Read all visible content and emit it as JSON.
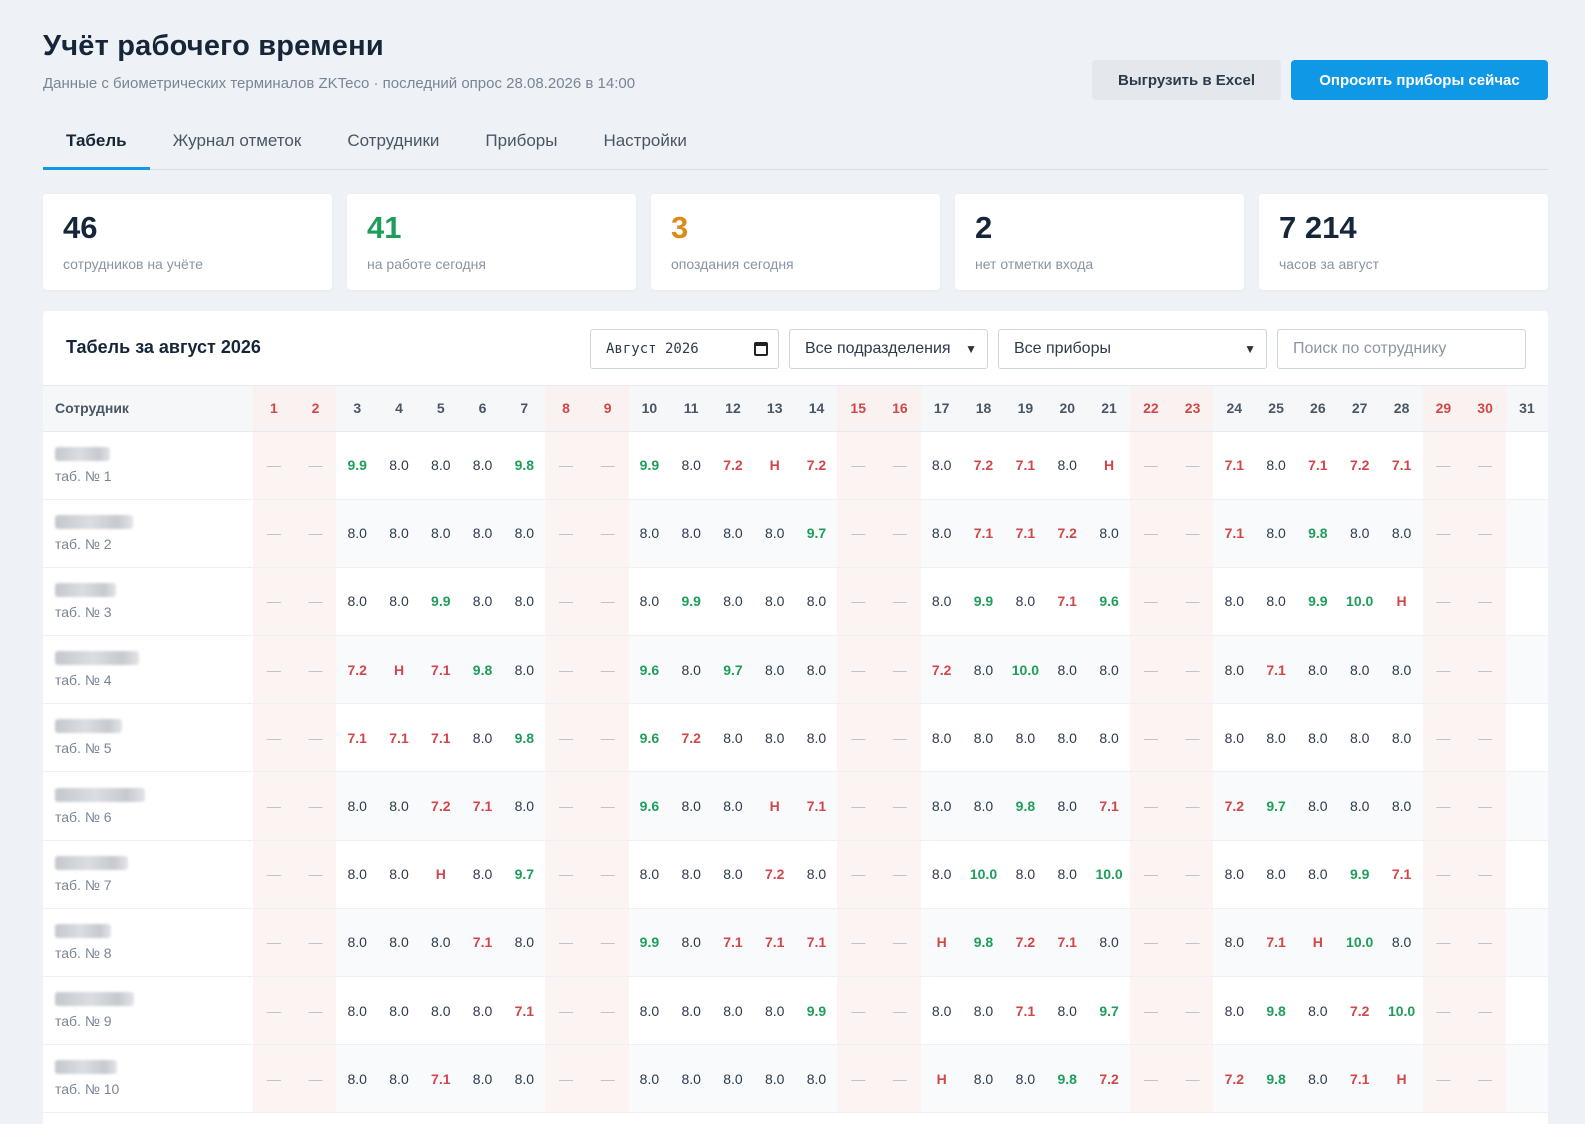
{
  "header": {
    "title": "Учёт рабочего времени",
    "subtitle": "Данные с биометрических терминалов ZKTeco · последний опрос 28.08.2026 в 14:00",
    "export_label": "Выгрузить в Excel",
    "poll_label": "Опросить приборы сейчас"
  },
  "tabs": [
    {
      "label": "Табель",
      "active": true
    },
    {
      "label": "Журнал отметок",
      "active": false
    },
    {
      "label": "Сотрудники",
      "active": false
    },
    {
      "label": "Приборы",
      "active": false
    },
    {
      "label": "Настройки",
      "active": false
    }
  ],
  "stats": [
    {
      "value": "46",
      "label": "сотрудников на учёте",
      "color": "#16263a"
    },
    {
      "value": "41",
      "label": "на работе сегодня",
      "color": "#1f9d5a"
    },
    {
      "value": "3",
      "label": "опоздания сегодня",
      "color": "#d98c1a"
    },
    {
      "value": "2",
      "label": "нет отметки входа",
      "color": "#16263a"
    },
    {
      "value": "7 214",
      "label": "часов за август",
      "color": "#16263a"
    }
  ],
  "timesheet": {
    "title": "Табель за август 2026",
    "month_value": "Август 2026",
    "dept_select": "Все подразделения",
    "device_select": "Все приборы",
    "search_placeholder": "Поиск по сотруднику",
    "employee_header": "Сотрудник",
    "days": [
      "1",
      "2",
      "3",
      "4",
      "5",
      "6",
      "7",
      "8",
      "9",
      "10",
      "11",
      "12",
      "13",
      "14",
      "15",
      "16",
      "17",
      "18",
      "19",
      "20",
      "21",
      "22",
      "23",
      "24",
      "25",
      "26",
      "27",
      "28",
      "29",
      "30",
      "31"
    ],
    "weekends": [
      1,
      2,
      8,
      9,
      15,
      16,
      22,
      23,
      29,
      30
    ],
    "rows": [
      {
        "tab": "таб. № 1",
        "values": [
          "—",
          "—",
          "9.9",
          "8.0",
          "8.0",
          "8.0",
          "9.8",
          "—",
          "—",
          "9.9",
          "8.0",
          "7.2",
          "Н",
          "7.2",
          "—",
          "—",
          "8.0",
          "7.2",
          "7.1",
          "8.0",
          "Н",
          "—",
          "—",
          "7.1",
          "8.0",
          "7.1",
          "7.2",
          "7.1",
          "—",
          "—"
        ]
      },
      {
        "tab": "таб. № 2",
        "values": [
          "—",
          "—",
          "8.0",
          "8.0",
          "8.0",
          "8.0",
          "8.0",
          "—",
          "—",
          "8.0",
          "8.0",
          "8.0",
          "8.0",
          "9.7",
          "—",
          "—",
          "8.0",
          "7.1",
          "7.1",
          "7.2",
          "8.0",
          "—",
          "—",
          "7.1",
          "8.0",
          "9.8",
          "8.0",
          "8.0",
          "—",
          "—"
        ]
      },
      {
        "tab": "таб. № 3",
        "values": [
          "—",
          "—",
          "8.0",
          "8.0",
          "9.9",
          "8.0",
          "8.0",
          "—",
          "—",
          "8.0",
          "9.9",
          "8.0",
          "8.0",
          "8.0",
          "—",
          "—",
          "8.0",
          "9.9",
          "8.0",
          "7.1",
          "9.6",
          "—",
          "—",
          "8.0",
          "8.0",
          "9.9",
          "10.0",
          "Н",
          "—",
          "—"
        ]
      },
      {
        "tab": "таб. № 4",
        "values": [
          "—",
          "—",
          "7.2",
          "Н",
          "7.1",
          "9.8",
          "8.0",
          "—",
          "—",
          "9.6",
          "8.0",
          "9.7",
          "8.0",
          "8.0",
          "—",
          "—",
          "7.2",
          "8.0",
          "10.0",
          "8.0",
          "8.0",
          "—",
          "—",
          "8.0",
          "7.1",
          "8.0",
          "8.0",
          "8.0",
          "—",
          "—"
        ]
      },
      {
        "tab": "таб. № 5",
        "values": [
          "—",
          "—",
          "7.1",
          "7.1",
          "7.1",
          "8.0",
          "9.8",
          "—",
          "—",
          "9.6",
          "7.2",
          "8.0",
          "8.0",
          "8.0",
          "—",
          "—",
          "8.0",
          "8.0",
          "8.0",
          "8.0",
          "8.0",
          "—",
          "—",
          "8.0",
          "8.0",
          "8.0",
          "8.0",
          "8.0",
          "—",
          "—"
        ]
      },
      {
        "tab": "таб. № 6",
        "values": [
          "—",
          "—",
          "8.0",
          "8.0",
          "7.2",
          "7.1",
          "8.0",
          "—",
          "—",
          "9.6",
          "8.0",
          "8.0",
          "Н",
          "7.1",
          "—",
          "—",
          "8.0",
          "8.0",
          "9.8",
          "8.0",
          "7.1",
          "—",
          "—",
          "7.2",
          "9.7",
          "8.0",
          "8.0",
          "8.0",
          "—",
          "—"
        ]
      },
      {
        "tab": "таб. № 7",
        "values": [
          "—",
          "—",
          "8.0",
          "8.0",
          "Н",
          "8.0",
          "9.7",
          "—",
          "—",
          "8.0",
          "8.0",
          "8.0",
          "7.2",
          "8.0",
          "—",
          "—",
          "8.0",
          "10.0",
          "8.0",
          "8.0",
          "10.0",
          "—",
          "—",
          "8.0",
          "8.0",
          "8.0",
          "9.9",
          "7.1",
          "—",
          "—"
        ]
      },
      {
        "tab": "таб. № 8",
        "values": [
          "—",
          "—",
          "8.0",
          "8.0",
          "8.0",
          "7.1",
          "8.0",
          "—",
          "—",
          "9.9",
          "8.0",
          "7.1",
          "7.1",
          "7.1",
          "—",
          "—",
          "Н",
          "9.8",
          "7.2",
          "7.1",
          "8.0",
          "—",
          "—",
          "8.0",
          "7.1",
          "Н",
          "10.0",
          "8.0",
          "—",
          "—"
        ]
      },
      {
        "tab": "таб. № 9",
        "values": [
          "—",
          "—",
          "8.0",
          "8.0",
          "8.0",
          "8.0",
          "7.1",
          "—",
          "—",
          "8.0",
          "8.0",
          "8.0",
          "8.0",
          "9.9",
          "—",
          "—",
          "8.0",
          "8.0",
          "7.1",
          "8.0",
          "9.7",
          "—",
          "—",
          "8.0",
          "9.8",
          "8.0",
          "7.2",
          "10.0",
          "—",
          "—"
        ]
      },
      {
        "tab": "таб. № 10",
        "values": [
          "—",
          "—",
          "8.0",
          "8.0",
          "7.1",
          "8.0",
          "8.0",
          "—",
          "—",
          "8.0",
          "8.0",
          "8.0",
          "8.0",
          "8.0",
          "—",
          "—",
          "Н",
          "8.0",
          "8.0",
          "9.8",
          "7.2",
          "—",
          "—",
          "7.2",
          "9.8",
          "8.0",
          "7.1",
          "Н",
          "—",
          "—"
        ]
      }
    ]
  }
}
